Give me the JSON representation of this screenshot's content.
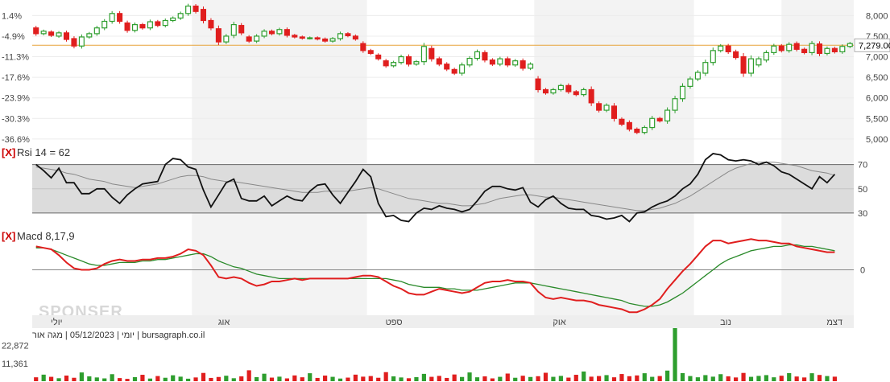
{
  "colors": {
    "up": "#2e9e2e",
    "down": "#e01e1e",
    "rsi_line": "#111111",
    "rsi_ma": "#888888",
    "macd_line": "#e01e1e",
    "signal_line": "#2a8a2a",
    "price_line": "#e8a33a",
    "band": "#dcdcdc",
    "month_shade": "#f3f3f3"
  },
  "watermark": "SPONSER",
  "chart_data": [
    {
      "type": "candlestick",
      "y_axis_right": [
        "8,000",
        "7,500",
        "7,000",
        "6,500",
        "6,000",
        "5,500",
        "5,000"
      ],
      "y_axis_left": [
        "1.4%",
        "-4.9%",
        "-11.3%",
        "-17.6%",
        "-23.9%",
        "-30.3%",
        "-36.6%"
      ],
      "ylim": [
        4900,
        8300
      ],
      "last_price_label": "7,279.00",
      "last_price": 7279,
      "x_month_labels": [
        "יולי",
        "אוג",
        "ספט",
        "אוק",
        "נוב",
        "דצמ"
      ],
      "footer_text": "יומי | 05/12/2023 | מגה אור | bursagraph.co.il",
      "candles": [
        [
          7700,
          7560
        ],
        [
          7560,
          7620
        ],
        [
          7600,
          7520
        ],
        [
          7500,
          7580
        ],
        [
          7580,
          7420
        ],
        [
          7440,
          7260
        ],
        [
          7260,
          7480
        ],
        [
          7480,
          7560
        ],
        [
          7560,
          7700
        ],
        [
          7700,
          7860
        ],
        [
          7860,
          8050
        ],
        [
          8050,
          7860
        ],
        [
          7820,
          7640
        ],
        [
          7640,
          7780
        ],
        [
          7780,
          7700
        ],
        [
          7700,
          7850
        ],
        [
          7850,
          7760
        ],
        [
          7760,
          7880
        ],
        [
          7880,
          7940
        ],
        [
          7940,
          8050
        ],
        [
          8050,
          8230
        ],
        [
          8230,
          8100
        ],
        [
          8150,
          7880
        ],
        [
          7880,
          7700
        ],
        [
          7680,
          7360
        ],
        [
          7360,
          7500
        ],
        [
          7520,
          7780
        ],
        [
          7760,
          7580
        ],
        [
          7480,
          7380
        ],
        [
          7380,
          7500
        ],
        [
          7500,
          7620
        ],
        [
          7620,
          7560
        ],
        [
          7560,
          7660
        ],
        [
          7660,
          7520
        ],
        [
          7520,
          7480
        ],
        [
          7480,
          7450
        ],
        [
          7450,
          7460
        ],
        [
          7460,
          7430
        ],
        [
          7430,
          7380
        ],
        [
          7380,
          7440
        ],
        [
          7440,
          7560
        ],
        [
          7560,
          7510
        ],
        [
          7500,
          7430
        ],
        [
          7320,
          7150
        ],
        [
          7150,
          7080
        ],
        [
          7040,
          6950
        ],
        [
          6900,
          6780
        ],
        [
          6780,
          6860
        ],
        [
          6860,
          7000
        ],
        [
          7000,
          6820
        ],
        [
          6820,
          6880
        ],
        [
          6880,
          7250
        ],
        [
          7200,
          6950
        ],
        [
          6950,
          6820
        ],
        [
          6820,
          6700
        ],
        [
          6690,
          6600
        ],
        [
          6600,
          6800
        ],
        [
          6800,
          6960
        ],
        [
          6960,
          7120
        ],
        [
          7100,
          6920
        ],
        [
          6920,
          6820
        ],
        [
          6820,
          6950
        ],
        [
          6950,
          6800
        ],
        [
          6800,
          6900
        ],
        [
          6900,
          6720
        ],
        [
          6720,
          6820
        ],
        [
          6460,
          6200
        ],
        [
          6200,
          6120
        ],
        [
          6120,
          6200
        ],
        [
          6200,
          6300
        ],
        [
          6300,
          6150
        ],
        [
          6150,
          6080
        ],
        [
          6080,
          6200
        ],
        [
          6200,
          5880
        ],
        [
          5860,
          5700
        ],
        [
          5700,
          5820
        ],
        [
          5800,
          5500
        ],
        [
          5480,
          5360
        ],
        [
          5400,
          5240
        ],
        [
          5240,
          5160
        ],
        [
          5160,
          5280
        ],
        [
          5280,
          5500
        ],
        [
          5500,
          5440
        ],
        [
          5440,
          5700
        ],
        [
          5700,
          5980
        ],
        [
          5980,
          6280
        ],
        [
          6280,
          6460
        ],
        [
          6460,
          6620
        ],
        [
          6600,
          6860
        ],
        [
          6860,
          7150
        ],
        [
          7150,
          7260
        ],
        [
          7260,
          7120
        ],
        [
          7120,
          6980
        ],
        [
          7000,
          6600
        ],
        [
          6600,
          6950
        ],
        [
          6800,
          6950
        ],
        [
          6920,
          7100
        ],
        [
          7100,
          7260
        ],
        [
          7260,
          7150
        ],
        [
          7150,
          7300
        ],
        [
          7320,
          7180
        ],
        [
          7180,
          7100
        ],
        [
          7100,
          7320
        ],
        [
          7310,
          7080
        ],
        [
          7080,
          7200
        ],
        [
          7200,
          7120
        ],
        [
          7120,
          7250
        ],
        [
          7250,
          7320
        ]
      ]
    },
    {
      "type": "line",
      "title": "Rsi 14 = 62",
      "close_button": "[X]",
      "y_ticks": [
        "70",
        "50",
        "30"
      ],
      "ylim": [
        20,
        85
      ],
      "overbought": 70,
      "oversold": 30,
      "series": [
        {
          "values": [
            70,
            65,
            59,
            67,
            55,
            55,
            46,
            46,
            50,
            50,
            43,
            38,
            45,
            50,
            54,
            55,
            56,
            70,
            75,
            74,
            68,
            66,
            49,
            35,
            45,
            55,
            58,
            42,
            40,
            40,
            44,
            36,
            40,
            44,
            41,
            40,
            48,
            53,
            54,
            45,
            38,
            47,
            56,
            66,
            60,
            38,
            27,
            28,
            24,
            23,
            30,
            34,
            33,
            36,
            34,
            33,
            31,
            33,
            40,
            48,
            52,
            52,
            50,
            49,
            51,
            39,
            35,
            41,
            44,
            38,
            34,
            33,
            33,
            28,
            27,
            25,
            26,
            28,
            23,
            30,
            31,
            35,
            38,
            40,
            44,
            50,
            54,
            62,
            74,
            79,
            78,
            74,
            73,
            74,
            73,
            70,
            72,
            69,
            64,
            62,
            58,
            54,
            50,
            60,
            55,
            62
          ]
        },
        {
          "values": [
            68,
            67,
            66,
            65,
            63,
            62,
            60,
            58,
            57,
            56,
            54,
            53,
            52,
            51,
            52,
            53,
            54,
            56,
            58,
            60,
            61,
            61,
            60,
            58,
            57,
            56,
            56,
            55,
            54,
            53,
            52,
            51,
            50,
            49,
            48,
            47,
            47,
            47,
            48,
            48,
            48,
            48,
            49,
            50,
            51,
            50,
            48,
            46,
            44,
            42,
            41,
            40,
            39,
            38,
            38,
            37,
            36,
            36,
            37,
            38,
            40,
            42,
            43,
            44,
            45,
            45,
            44,
            43,
            43,
            42,
            41,
            40,
            39,
            38,
            37,
            36,
            35,
            34,
            33,
            32,
            32,
            33,
            34,
            36,
            38,
            41,
            44,
            48,
            52,
            56,
            60,
            64,
            67,
            69,
            71,
            72,
            72,
            72,
            71,
            70,
            69,
            67,
            65,
            64,
            63,
            61
          ]
        }
      ]
    },
    {
      "type": "line",
      "title": "Macd 8,17,9",
      "close_button": "[X]",
      "y_ticks": [
        "0"
      ],
      "ylim": [
        -30,
        25
      ],
      "series": [
        {
          "values": [
            16,
            15,
            14,
            10,
            5,
            1,
            0,
            0,
            1,
            4,
            6,
            7,
            6,
            6,
            7,
            7,
            8,
            8,
            9,
            11,
            14,
            13,
            10,
            3,
            -5,
            -6,
            -5,
            -6,
            -9,
            -11,
            -10,
            -8,
            -8,
            -7,
            -6,
            -7,
            -6,
            -6,
            -6,
            -6,
            -6,
            -6,
            -5,
            -4,
            -4,
            -5,
            -8,
            -11,
            -13,
            -16,
            -17,
            -17,
            -15,
            -13,
            -14,
            -15,
            -16,
            -15,
            -12,
            -9,
            -8,
            -8,
            -7,
            -8,
            -8,
            -9,
            -15,
            -19,
            -20,
            -19,
            -20,
            -21,
            -21,
            -22,
            -24,
            -25,
            -26,
            -27,
            -29,
            -29,
            -27,
            -24,
            -20,
            -13,
            -7,
            -1,
            4,
            10,
            16,
            20,
            20,
            18,
            19,
            20,
            21,
            20,
            20,
            19,
            18,
            18,
            16,
            15,
            14,
            13,
            12,
            12
          ]
        },
        {
          "values": [
            15,
            15,
            14,
            12,
            10,
            8,
            6,
            4,
            3,
            3,
            4,
            5,
            5,
            5,
            6,
            6,
            7,
            7,
            8,
            9,
            10,
            11,
            11,
            9,
            6,
            4,
            2,
            1,
            -1,
            -3,
            -4,
            -5,
            -6,
            -6,
            -6,
            -6,
            -6,
            -6,
            -6,
            -6,
            -6,
            -6,
            -6,
            -6,
            -6,
            -6,
            -6,
            -7,
            -8,
            -10,
            -11,
            -12,
            -12,
            -12,
            -13,
            -13,
            -14,
            -14,
            -14,
            -13,
            -12,
            -11,
            -10,
            -9,
            -9,
            -9,
            -10,
            -11,
            -12,
            -13,
            -14,
            -15,
            -16,
            -17,
            -18,
            -19,
            -20,
            -21,
            -23,
            -24,
            -25,
            -25,
            -24,
            -22,
            -19,
            -16,
            -12,
            -8,
            -4,
            0,
            4,
            7,
            9,
            11,
            13,
            14,
            15,
            16,
            16,
            17,
            17,
            16,
            16,
            15,
            14,
            13
          ]
        }
      ]
    },
    {
      "type": "bar",
      "y_ticks": [
        "22,872",
        "11,361"
      ],
      "ylim": [
        0,
        34000
      ],
      "values": [
        2500,
        4200,
        2800,
        1900,
        3600,
        2200,
        5600,
        3100,
        2400,
        1800,
        4500,
        2000,
        1500,
        2600,
        4100,
        1700,
        3300,
        2200,
        3800,
        2900,
        1600,
        2400,
        5300,
        2100,
        2700,
        3500,
        1900,
        3100,
        7000,
        2600,
        4800,
        2300,
        2900,
        1800,
        3700,
        2500,
        5100,
        2100,
        3600,
        2800,
        1700,
        2300,
        4200,
        2900,
        3300,
        2200,
        5800,
        3100,
        2400,
        1900,
        2600,
        4700,
        2800,
        3400,
        2100,
        4300,
        2700,
        5600,
        2500,
        3100,
        1800,
        2800,
        4900,
        2200,
        3500,
        2700,
        3200,
        5400,
        2800,
        3400,
        2300,
        4100,
        6200,
        2900,
        3300,
        3900,
        2500,
        4600,
        3200,
        3700,
        5100,
        2800,
        3300,
        6800,
        34000,
        5200,
        3300,
        2500,
        3900,
        2900,
        4500,
        3100,
        2400,
        5300,
        2800,
        3400,
        3900,
        2500,
        3500,
        5200,
        3000,
        2400,
        5100,
        4000,
        3300,
        2900
      ]
    }
  ]
}
